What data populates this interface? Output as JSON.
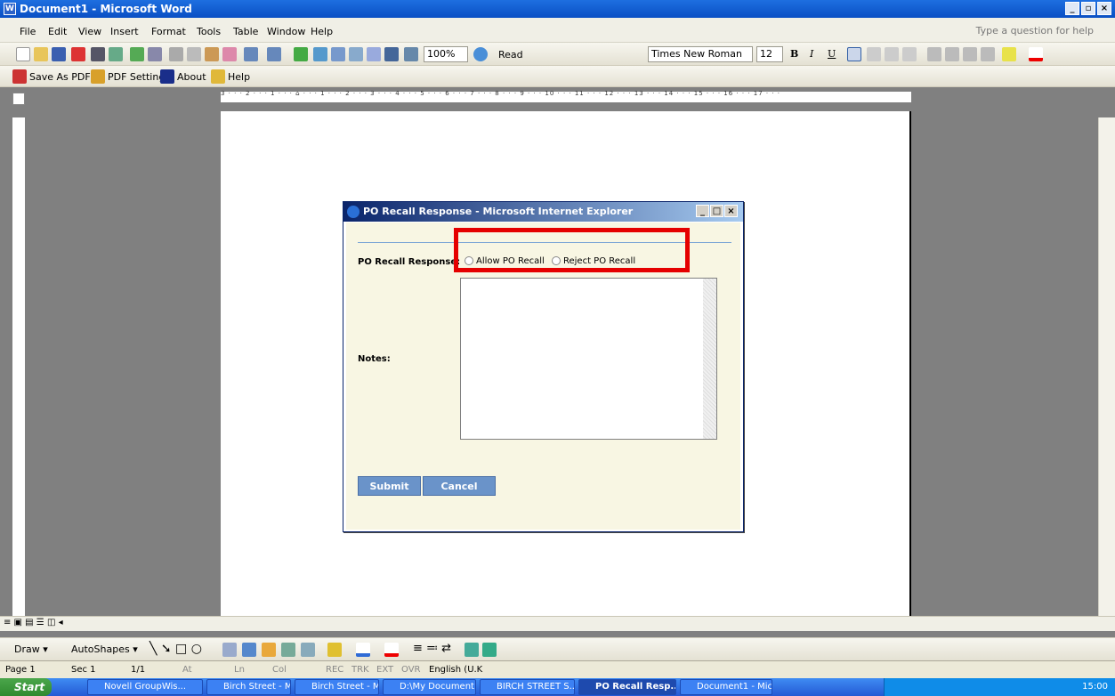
{
  "window": {
    "title": "Document1 - Microsoft Word",
    "controls": [
      "_",
      "▫",
      "×"
    ]
  },
  "menu": {
    "items": [
      "File",
      "Edit",
      "View",
      "Insert",
      "Format",
      "Tools",
      "Table",
      "Window",
      "Help"
    ],
    "help_placeholder": "Type a question for help"
  },
  "toolbar": {
    "zoom": "100%",
    "read_label": "Read",
    "font_name": "Times New Roman",
    "font_size": "12",
    "bold": "B",
    "italic": "I",
    "underline": "U"
  },
  "pdf_toolbar": {
    "save_pdf": "Save As PDF",
    "pdf_setting": "PDF Setting",
    "about": "About",
    "help": "Help"
  },
  "ruler": {
    "text": "3 · · · 2 · · · 1 · · · ⌂ · · · 1 · · · 2 · · · 3 · · · 4 · · · 5 · · · 6 · · · 7 · · · 8 · · · 9 · · · 10 · · · 11 · · · 12 · · · 13 · · · 14 · · · 15 · · · 16 · · · 17 · · ·"
  },
  "dialog": {
    "title": "PO Recall Response - Microsoft Internet Explorer",
    "response_label": "PO Recall Response:",
    "option_allow": "Allow PO Recall",
    "option_reject": "Reject PO Recall",
    "notes_label": "Notes:",
    "submit": "Submit",
    "cancel": "Cancel"
  },
  "drawbar": {
    "draw": "Draw ▾",
    "autoshapes": "AutoShapes ▾"
  },
  "status": {
    "page": "Page 1",
    "sec": "Sec 1",
    "pages": "1/1",
    "at": "At",
    "ln": "Ln",
    "col": "Col",
    "rec": "REC",
    "trk": "TRK",
    "ext": "EXT",
    "ovr": "OVR",
    "lang": "English (U.K"
  },
  "taskbar": {
    "start": "Start",
    "tasks": [
      "Novell GroupWis...",
      "Birch Street - Mi...",
      "Birch Street - Mi...",
      "D:\\My Document...",
      "BIRCH STREET S...",
      "PO Recall Resp...",
      "Document1 - Mic..."
    ],
    "clock": "15:00"
  },
  "colors": {
    "highlight": "#e50000",
    "button": "#6a93c9",
    "titlebar": "#0a4fc4"
  }
}
